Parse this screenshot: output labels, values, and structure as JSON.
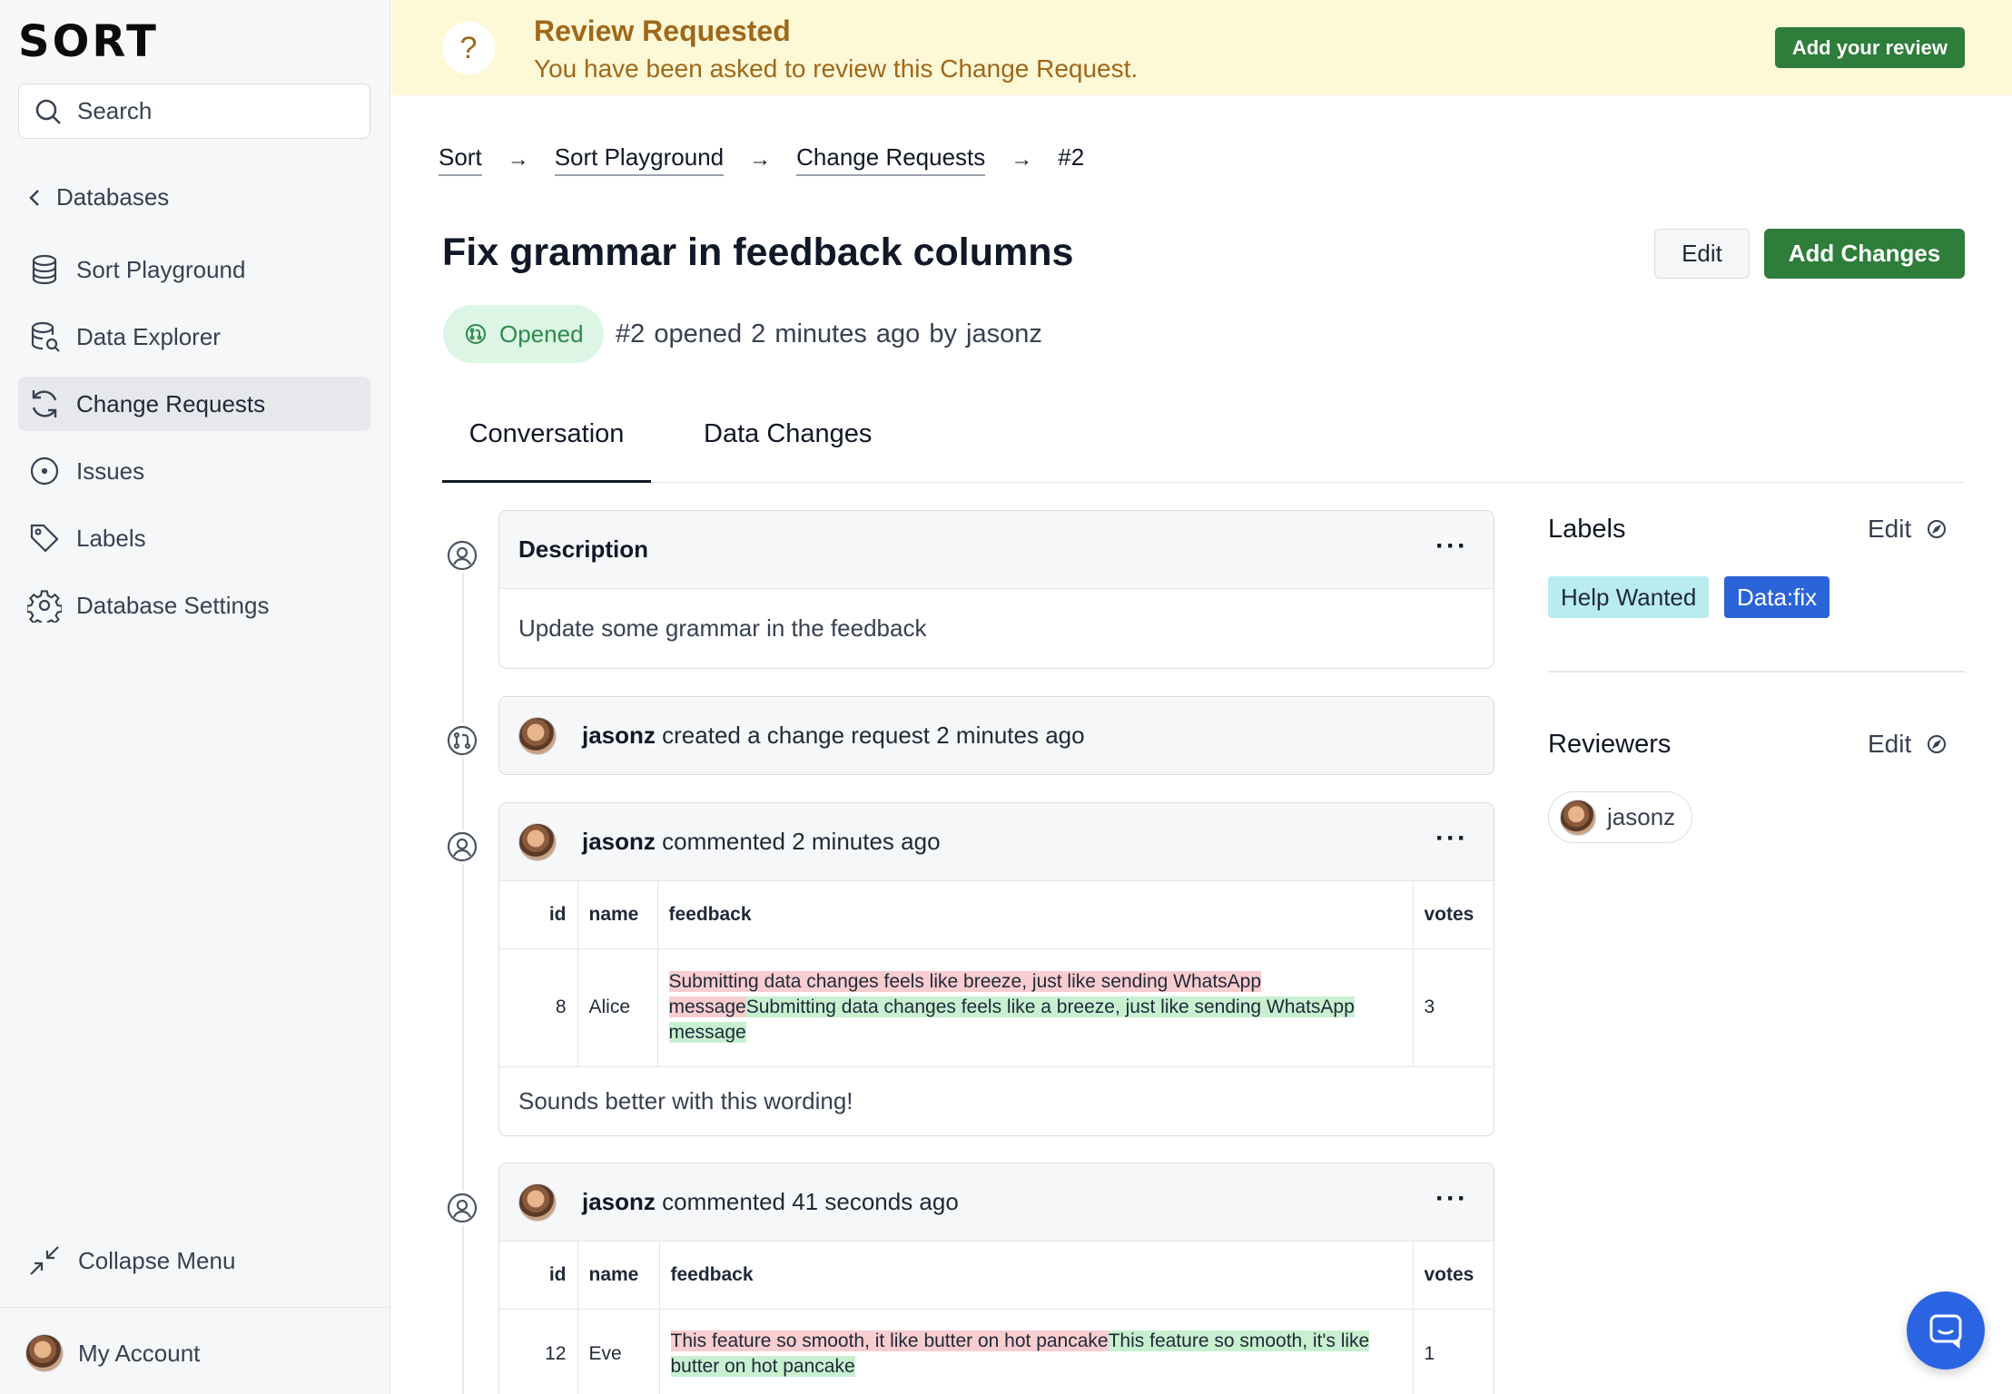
{
  "app": {
    "logo": "SORT"
  },
  "sidebar": {
    "search_label": "Search",
    "back_label": "Databases",
    "items": [
      {
        "label": "Sort Playground",
        "icon": "database-icon"
      },
      {
        "label": "Data Explorer",
        "icon": "database-search-icon"
      },
      {
        "label": "Change Requests",
        "icon": "refresh-icon",
        "active": true
      },
      {
        "label": "Issues",
        "icon": "issue-circle-icon"
      },
      {
        "label": "Labels",
        "icon": "tag-icon"
      },
      {
        "label": "Database Settings",
        "icon": "gear-icon"
      }
    ],
    "collapse_label": "Collapse Menu",
    "account_label": "My Account"
  },
  "banner": {
    "title": "Review Requested",
    "subtitle": "You have been asked to review this Change Request.",
    "button": "Add your review",
    "icon": "question-icon"
  },
  "breadcrumb": [
    "Sort",
    "Sort Playground",
    "Change Requests",
    "#2"
  ],
  "header": {
    "title": "Fix grammar in feedback columns",
    "edit_button": "Edit",
    "add_button": "Add Changes",
    "status": "Opened",
    "meta": "#2 opened  2 minutes ago  by jasonz"
  },
  "tabs": [
    "Conversation",
    "Data Changes"
  ],
  "timeline": {
    "description": {
      "title": "Description",
      "body": "Update some grammar in the feedback",
      "more": "···"
    },
    "event": {
      "user": "jasonz",
      "text": " created a change request 2 minutes ago"
    },
    "comment1": {
      "user": "jasonz",
      "text": " commented 2 minutes ago",
      "more": "···",
      "columns": [
        "id",
        "name",
        "feedback",
        "votes"
      ],
      "row": {
        "id": "8",
        "name": "Alice",
        "feedback_old": "Submitting data changes feels like breeze, just like sending WhatsApp message",
        "feedback_new": "Submitting data changes feels like a breeze, just like sending WhatsApp message",
        "votes": "3"
      },
      "body": "Sounds better with this wording!"
    },
    "comment2": {
      "user": "jasonz",
      "text": " commented 41 seconds ago",
      "more": "···",
      "columns": [
        "id",
        "name",
        "feedback",
        "votes"
      ],
      "row": {
        "id": "12",
        "name": "Eve",
        "feedback_old": "This feature so smooth, it like butter on hot pancake",
        "feedback_new": "This feature so smooth, it's like butter on hot pancake",
        "votes": "1"
      }
    }
  },
  "side": {
    "labels_title": "Labels",
    "labels_edit": "Edit",
    "labels": [
      {
        "text": "Help Wanted",
        "bg": "#b9ecee",
        "fg": "#1f2937"
      },
      {
        "text": "Data:fix",
        "bg": "#2b64d8",
        "fg": "#ffffff"
      }
    ],
    "reviewers_title": "Reviewers",
    "reviewers_edit": "Edit",
    "reviewer": "jasonz"
  },
  "colors": {
    "accent_green": "#2e7d3a",
    "banner_bg": "#fdf8d6",
    "banner_text": "#a0681a",
    "diff_removed": "#f8cdd0",
    "diff_added": "#c8f0d0",
    "chat_button": "#2b64e3"
  }
}
